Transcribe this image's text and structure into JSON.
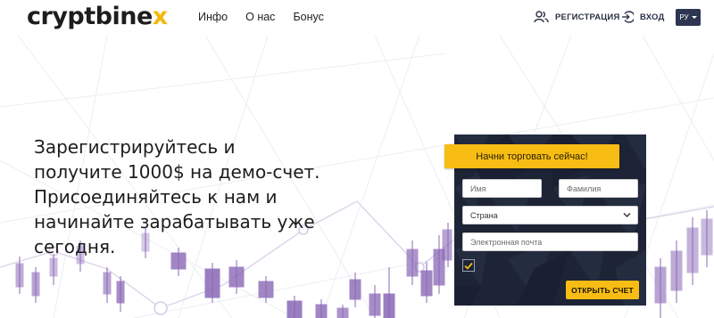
{
  "header": {
    "logo": {
      "text_main": "cryptbine",
      "text_accent": "x"
    },
    "nav": [
      {
        "label": "Инфо"
      },
      {
        "label": "О нас"
      },
      {
        "label": "Бонус"
      }
    ],
    "register_label": "РЕГИСТРАЦИЯ",
    "login_label": "ВХОД",
    "language": "РУ"
  },
  "hero": {
    "headline_lines": [
      "Зарегистрируйтесь и",
      "получите 1000$ на демо-счет.",
      "Присоединяйтесь к нам и",
      "начинайте зарабатывать уже",
      "сегодня."
    ]
  },
  "form": {
    "banner": "Начни торговать сейчас!",
    "first_name_placeholder": "Имя",
    "last_name_placeholder": "Фамилия",
    "country_value": "Страна",
    "email_placeholder": "Электронная почта",
    "terms_checked": true,
    "submit_label": "ОТКРЫТЬ СЧЕТ"
  },
  "colors": {
    "accent": "#f7bd14",
    "panel": "#1d2435",
    "candles": "#8a68b6",
    "language_button": "#2e3552"
  },
  "icons": {
    "register": "users-icon",
    "login": "login-arrow-icon",
    "language_caret": "caret-down-icon",
    "country_chevron": "chevron-down-icon",
    "checkbox": "checkmark-icon"
  }
}
